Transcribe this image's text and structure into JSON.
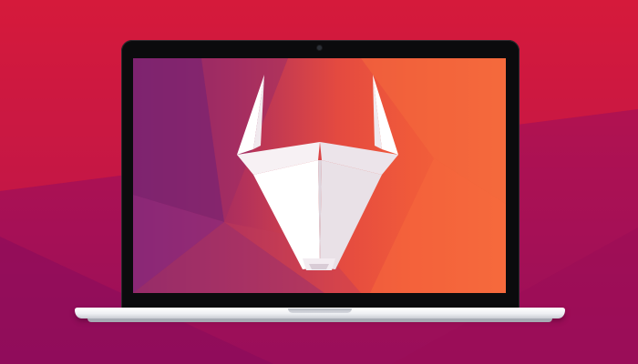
{
  "scene": {
    "subject": "laptop-with-mascot",
    "colors": {
      "background_top": "#d8193a",
      "background_bottom": "#8f0d5e",
      "bezel": "#0b0b0d",
      "screen_left": "#7a1f6d",
      "screen_right": "#f46a3d",
      "mascot": "#ffffff",
      "base": "#eef0f3"
    },
    "icons": {
      "mascot": "bull-head-icon",
      "camera": "camera-icon"
    }
  }
}
